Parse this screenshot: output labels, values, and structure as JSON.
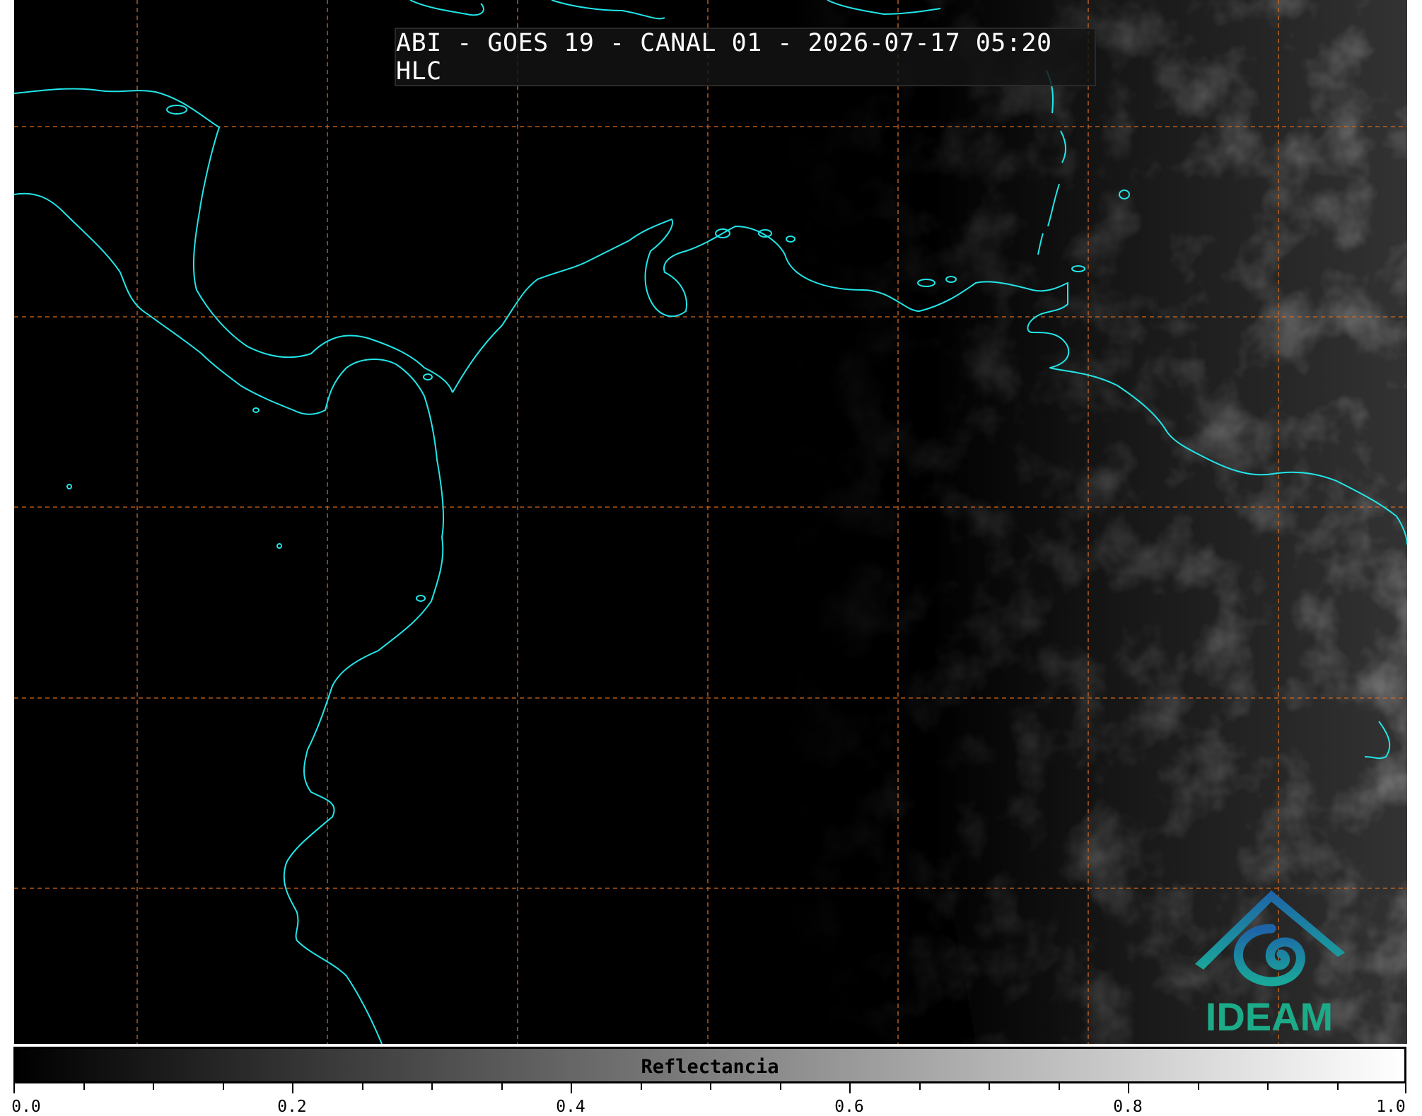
{
  "title": "ABI - GOES 19 - CANAL 01 - 2026-07-17 05:20 HLC",
  "colorbar": {
    "label": "Reflectancia",
    "min": 0.0,
    "max": 1.0,
    "major_ticks": [
      "0.0",
      "0.2",
      "0.4",
      "0.6",
      "0.8",
      "1.0"
    ],
    "minor_step": 0.05,
    "colormap_start": "#000000",
    "colormap_end": "#ffffff"
  },
  "map": {
    "background": "#000000",
    "coastline_color": "#22e5e8",
    "gridline_color": "#d2691e",
    "gridline_style": "dashed"
  },
  "logo": {
    "text": "IDEAM",
    "roof_color": "#1e63a8",
    "swirl_color": "#1aa79a",
    "text_color": "#1cab88"
  }
}
